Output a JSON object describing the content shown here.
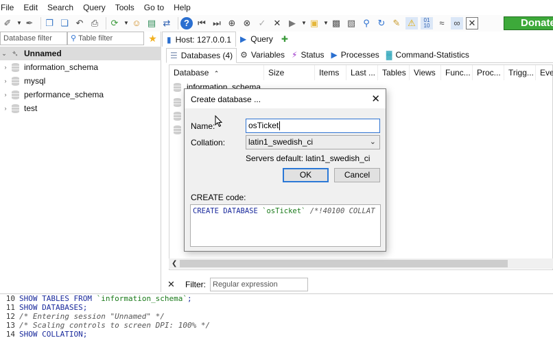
{
  "menu": [
    "File",
    "Edit",
    "Search",
    "Query",
    "Tools",
    "Go to",
    "Help"
  ],
  "toolbar": {
    "donate_label": "Donate"
  },
  "left_panel": {
    "db_filter_placeholder": "Database filter",
    "table_filter_placeholder": "Table filter",
    "session": "Unnamed",
    "databases": [
      "information_schema",
      "mysql",
      "performance_schema",
      "test"
    ]
  },
  "host_tabs": [
    {
      "label": "Host: 127.0.0.1",
      "icon": "host-icon"
    },
    {
      "label": "Query",
      "icon": "play-icon"
    }
  ],
  "sub_tabs": [
    {
      "label": "Databases (4)",
      "icon": "database-icon"
    },
    {
      "label": "Variables",
      "icon": "gear-icon"
    },
    {
      "label": "Status",
      "icon": "lightning-icon"
    },
    {
      "label": "Processes",
      "icon": "play-icon"
    },
    {
      "label": "Command-Statistics",
      "icon": "bar-chart-icon"
    }
  ],
  "grid": {
    "columns": [
      "Database",
      "Size",
      "Items",
      "Last ...",
      "Tables",
      "Views",
      "Func...",
      "Proc...",
      "Trigg...",
      "Ever"
    ],
    "rows": [
      "information_schema"
    ]
  },
  "filter": {
    "label": "Filter:",
    "placeholder": "Regular expression"
  },
  "sql_log": [
    {
      "num": "10",
      "parts": [
        [
          "kw",
          "SHOW TABLES FROM "
        ],
        [
          "str",
          "`information_schema`"
        ],
        [
          "kw",
          ";"
        ]
      ]
    },
    {
      "num": "11",
      "parts": [
        [
          "kw",
          "SHOW DATABASES;"
        ]
      ]
    },
    {
      "num": "12",
      "parts": [
        [
          "cmt",
          "/* Entering session \"Unnamed\" */"
        ]
      ]
    },
    {
      "num": "13",
      "parts": [
        [
          "cmt",
          "/* Scaling controls to screen DPI: 100% */"
        ]
      ]
    },
    {
      "num": "14",
      "parts": [
        [
          "kw",
          "SHOW COLLATION;"
        ]
      ]
    }
  ],
  "dialog": {
    "title": "Create database ...",
    "name_label": "Name:",
    "name_value": "osTicket",
    "collation_label": "Collation:",
    "collation_value": "latin1_swedish_ci",
    "servers_default": "Servers default: latin1_swedish_ci",
    "ok_label": "OK",
    "cancel_label": "Cancel",
    "create_code_label": "CREATE code:",
    "create_code": {
      "kw": "CREATE DATABASE ",
      "str": "`osTicket`",
      "cmt": " /*!40100 COLLAT"
    }
  },
  "colors": {
    "accent": "#2b78d6",
    "donate": "#3da93a",
    "keyword": "#1a2a9c",
    "string": "#1a7a1a"
  }
}
